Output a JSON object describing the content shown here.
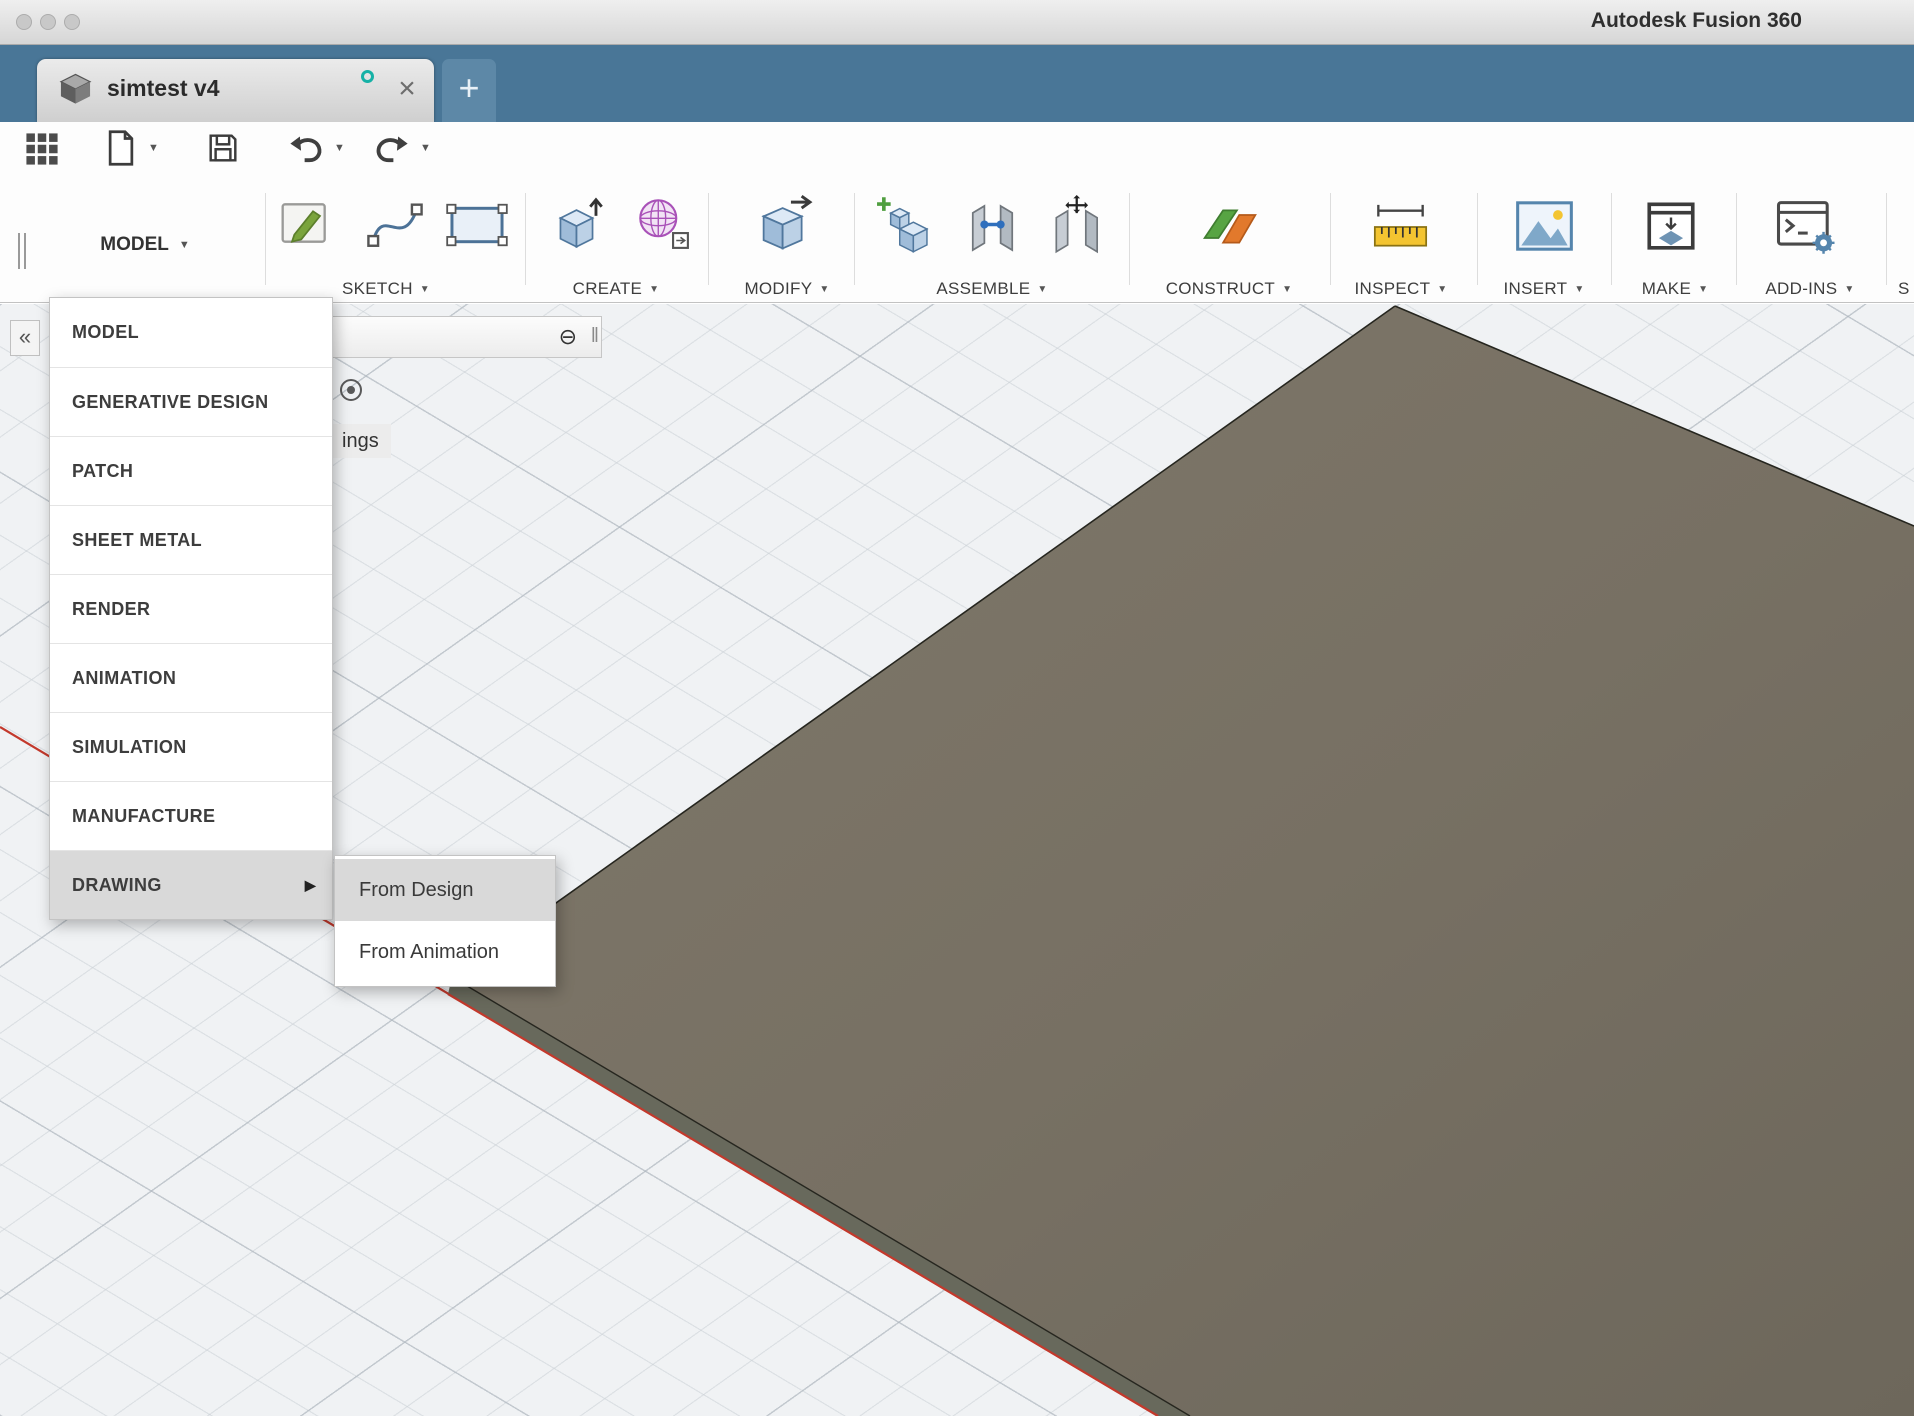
{
  "window": {
    "title": "Autodesk Fusion 360"
  },
  "icons": {
    "caret_down": "▼",
    "submenu_arrow": "▶",
    "close": "×",
    "plus": "+",
    "collapse_left": "«",
    "minimize_circle": "⊖",
    "grip": "‖"
  },
  "tab": {
    "title": "simtest v4"
  },
  "ribbon": {
    "workspace": "MODEL",
    "groups": [
      {
        "label": "SKETCH"
      },
      {
        "label": "CREATE"
      },
      {
        "label": "MODIFY"
      },
      {
        "label": "ASSEMBLE"
      },
      {
        "label": "CONSTRUCT"
      },
      {
        "label": "INSPECT"
      },
      {
        "label": "INSERT"
      },
      {
        "label": "MAKE"
      },
      {
        "label": "ADD-INS"
      },
      {
        "label": "S"
      }
    ]
  },
  "browser": {
    "fragment": "ings"
  },
  "workspace_menu": {
    "items": [
      "MODEL",
      "GENERATIVE DESIGN",
      "PATCH",
      "SHEET METAL",
      "RENDER",
      "ANIMATION",
      "SIMULATION",
      "MANUFACTURE",
      "DRAWING"
    ],
    "highlighted": "DRAWING"
  },
  "drawing_submenu": {
    "items": [
      "From Design",
      "From Animation"
    ],
    "highlighted": "From Design"
  },
  "colors": {
    "header_blue": "#497697",
    "body_top_face": "#777063",
    "body_side_face": "#68695c",
    "axis_red": "#c3392c",
    "menu_highlight": "#d9d9d9"
  }
}
